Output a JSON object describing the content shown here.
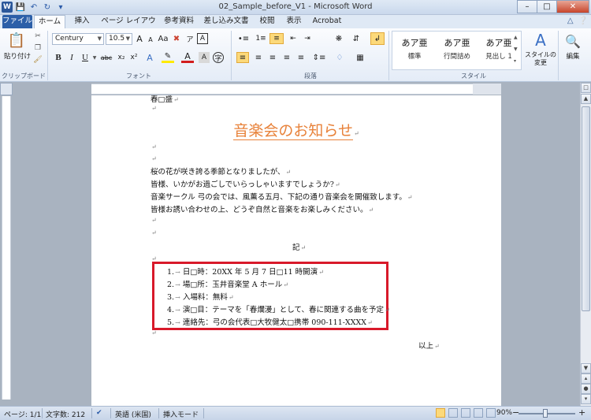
{
  "window": {
    "title": "02_Sample_before_V1 - Microsoft Word",
    "min": "–",
    "max": "□",
    "close": "✕"
  },
  "tabs": {
    "file": "ファイル",
    "home": "ホーム",
    "insert": "挿入",
    "layout": "ページ レイアウト",
    "references": "参考資料",
    "mailings": "差し込み文書",
    "review": "校閲",
    "view": "表示",
    "acrobat": "Acrobat"
  },
  "ribbon": {
    "paste": "貼り付け",
    "font_name": "Century",
    "font_size": "10.5",
    "group_clipboard": "クリップボード",
    "group_font": "フォント",
    "group_paragraph": "段落",
    "group_styles": "スタイル",
    "styles": [
      {
        "sample": "あア亜",
        "name": "標準"
      },
      {
        "sample": "あア亜",
        "name": "行間詰め"
      },
      {
        "sample": "あア亜",
        "name": "見出し 1"
      }
    ],
    "change_styles": "スタイルの\n変更",
    "editing": "編集",
    "bold": "B",
    "italic": "I",
    "underline": "U",
    "strike": "abc",
    "sub": "x₂",
    "sup": "x²",
    "grow": "A",
    "shrink": "A"
  },
  "document": {
    "top_cut": "春□盛",
    "title": "音楽会のお知らせ",
    "body": [
      "桜の花が咲き誇る季節となりましたが、",
      "皆様、いかがお過ごしでいらっしゃいますでしょうか?",
      "音楽サークル 弓の会では、風薫る五月、下記の通り音楽会を開催致します。",
      "皆様お誘い合わせの上、どうぞ自然と音楽をお楽しみください。"
    ],
    "ki": "記",
    "list": [
      {
        "num": "1.",
        "text": "日□時：20XX 年 5 月 7 日□11 時開演"
      },
      {
        "num": "2.",
        "text": "場□所：玉井音楽堂 A ホール"
      },
      {
        "num": "3.",
        "text": "入場料：無料"
      },
      {
        "num": "4.",
        "text": "演□目：テーマを「春爛漫」として、春に関連する曲を予定"
      },
      {
        "num": "5.",
        "text": "連絡先：弓の会代表□大牧健太□携帯 090-111-XXXX"
      }
    ],
    "closing": "以上",
    "para_mark": "↵",
    "tab_mark": "→"
  },
  "status": {
    "page": "ページ: 1/1",
    "words": "文字数: 212",
    "language": "英語 (米国)",
    "mode": "挿入モード",
    "zoom": "90%",
    "zoom_minus": "−",
    "zoom_plus": "+"
  },
  "colors": {
    "title_orange": "#e8823a",
    "highlight_red": "#d8192a",
    "file_tab_blue": "#2c5fa8"
  }
}
